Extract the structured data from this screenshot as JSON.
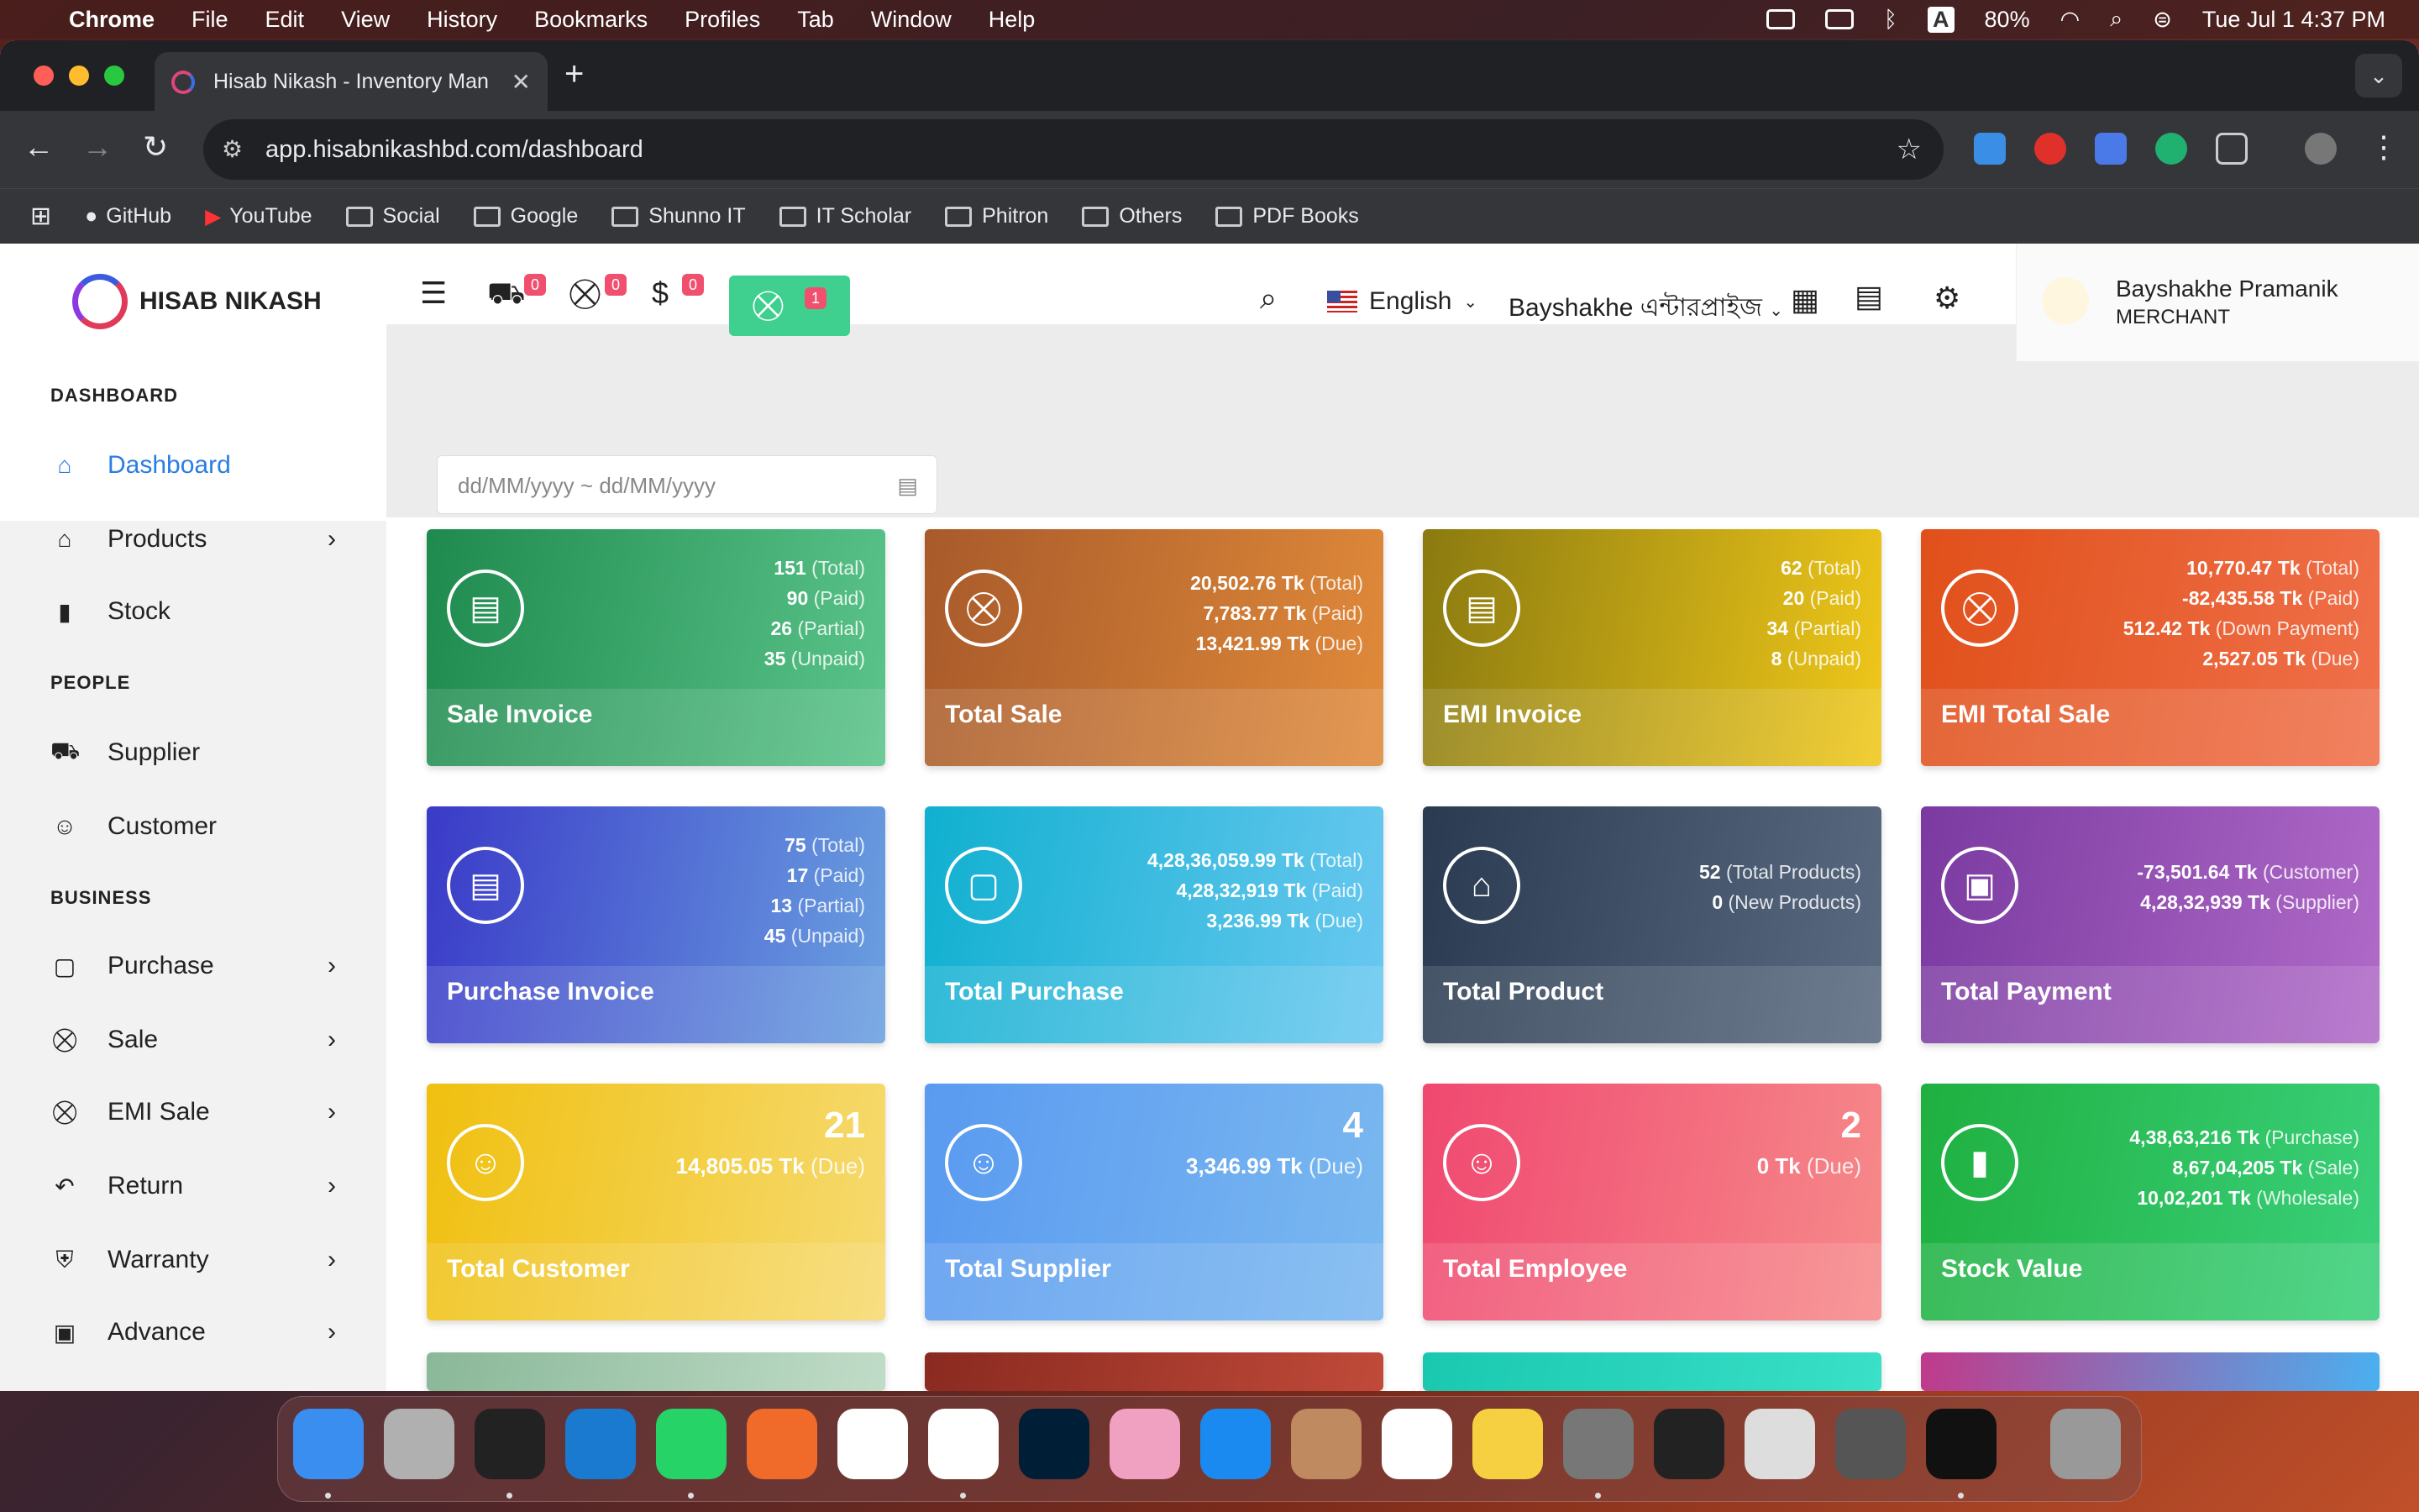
{
  "menubar": {
    "app": "Chrome",
    "items": [
      "File",
      "Edit",
      "View",
      "History",
      "Bookmarks",
      "Profiles",
      "Tab",
      "Window",
      "Help"
    ],
    "battery": "80%",
    "clock": "Tue Jul 1  4:37 PM",
    "input_source": "A"
  },
  "browser": {
    "tab_title": "Hisab Nikash - Inventory Man",
    "url": "app.hisabnikashbd.com/dashboard",
    "bookmarks": [
      "GitHub",
      "YouTube",
      "Social",
      "Google",
      "Shunno IT",
      "IT Scholar",
      "Phitron",
      "Others",
      "PDF Books"
    ]
  },
  "app": {
    "logo_text": "HISAB NIKASH",
    "sidebar": {
      "sections": [
        "DASHBOARD",
        "PEOPLE",
        "BUSINESS"
      ],
      "items": [
        {
          "label": "Dashboard",
          "icon": "home-icon"
        },
        {
          "label": "Products",
          "icon": "store-icon"
        },
        {
          "label": "Stock",
          "icon": "bar-chart-icon"
        },
        {
          "label": "Supplier",
          "icon": "truck-icon"
        },
        {
          "label": "Customer",
          "icon": "users-icon"
        },
        {
          "label": "Purchase",
          "icon": "bag-icon"
        },
        {
          "label": "Sale",
          "icon": "cart-icon"
        },
        {
          "label": "EMI Sale",
          "icon": "cart-plus-icon"
        },
        {
          "label": "Return",
          "icon": "return-icon"
        },
        {
          "label": "Warranty",
          "icon": "shield-icon"
        },
        {
          "label": "Advance",
          "icon": "id-card-icon"
        }
      ]
    },
    "topbar": {
      "badges": {
        "delivery": "0",
        "cart": "0",
        "payment": "0",
        "pos_cart": "1"
      },
      "language": "English",
      "business": "Bayshakhe এন্টারপ্রাইজ",
      "user_name": "Bayshakhe Pramanik",
      "user_role": "MERCHANT"
    },
    "date_placeholder": "dd/MM/yyyy ~ dd/MM/yyyy",
    "cards": [
      {
        "title": "Sale Invoice",
        "lines": [
          [
            "151",
            "(Total)"
          ],
          [
            "90",
            "(Paid)"
          ],
          [
            "26",
            "(Partial)"
          ],
          [
            "35",
            "(Unpaid)"
          ]
        ]
      },
      {
        "title": "Total Sale",
        "lines": [
          [
            "20,502.76 Tk",
            "(Total)"
          ],
          [
            "7,783.77 Tk",
            "(Paid)"
          ],
          [
            "13,421.99 Tk",
            "(Due)"
          ]
        ]
      },
      {
        "title": "EMI Invoice",
        "lines": [
          [
            "62",
            "(Total)"
          ],
          [
            "20",
            "(Paid)"
          ],
          [
            "34",
            "(Partial)"
          ],
          [
            "8",
            "(Unpaid)"
          ]
        ]
      },
      {
        "title": "EMI Total Sale",
        "lines": [
          [
            "10,770.47 Tk",
            "(Total)"
          ],
          [
            "-82,435.58 Tk",
            "(Paid)"
          ],
          [
            "512.42 Tk",
            "(Down Payment)"
          ],
          [
            "2,527.05 Tk",
            "(Due)"
          ]
        ]
      },
      {
        "title": "Purchase Invoice",
        "lines": [
          [
            "75",
            "(Total)"
          ],
          [
            "17",
            "(Paid)"
          ],
          [
            "13",
            "(Partial)"
          ],
          [
            "45",
            "(Unpaid)"
          ]
        ]
      },
      {
        "title": "Total Purchase",
        "lines": [
          [
            "4,28,36,059.99 Tk",
            "(Total)"
          ],
          [
            "4,28,32,919 Tk",
            "(Paid)"
          ],
          [
            "3,236.99 Tk",
            "(Due)"
          ]
        ]
      },
      {
        "title": "Total Product",
        "lines": [
          [
            "52",
            "(Total Products)"
          ],
          [
            "0",
            "(New Products)"
          ]
        ]
      },
      {
        "title": "Total Payment",
        "lines": [
          [
            "-73,501.64 Tk",
            "(Customer)"
          ],
          [
            "4,28,32,939 Tk",
            "(Supplier)"
          ]
        ]
      },
      {
        "title": "Total Customer",
        "big": "21",
        "lines": [
          [
            "14,805.05 Tk",
            "(Due)"
          ]
        ]
      },
      {
        "title": "Total Supplier",
        "big": "4",
        "lines": [
          [
            "3,346.99 Tk",
            "(Due)"
          ]
        ]
      },
      {
        "title": "Total Employee",
        "big": "2",
        "lines": [
          [
            "0 Tk",
            "(Due)"
          ]
        ]
      },
      {
        "title": "Stock Value",
        "lines": [
          [
            "4,38,63,216 Tk",
            "(Purchase)"
          ],
          [
            "8,67,04,205 Tk",
            "(Sale)"
          ],
          [
            "10,02,201 Tk",
            "(Wholesale)"
          ]
        ]
      }
    ]
  }
}
